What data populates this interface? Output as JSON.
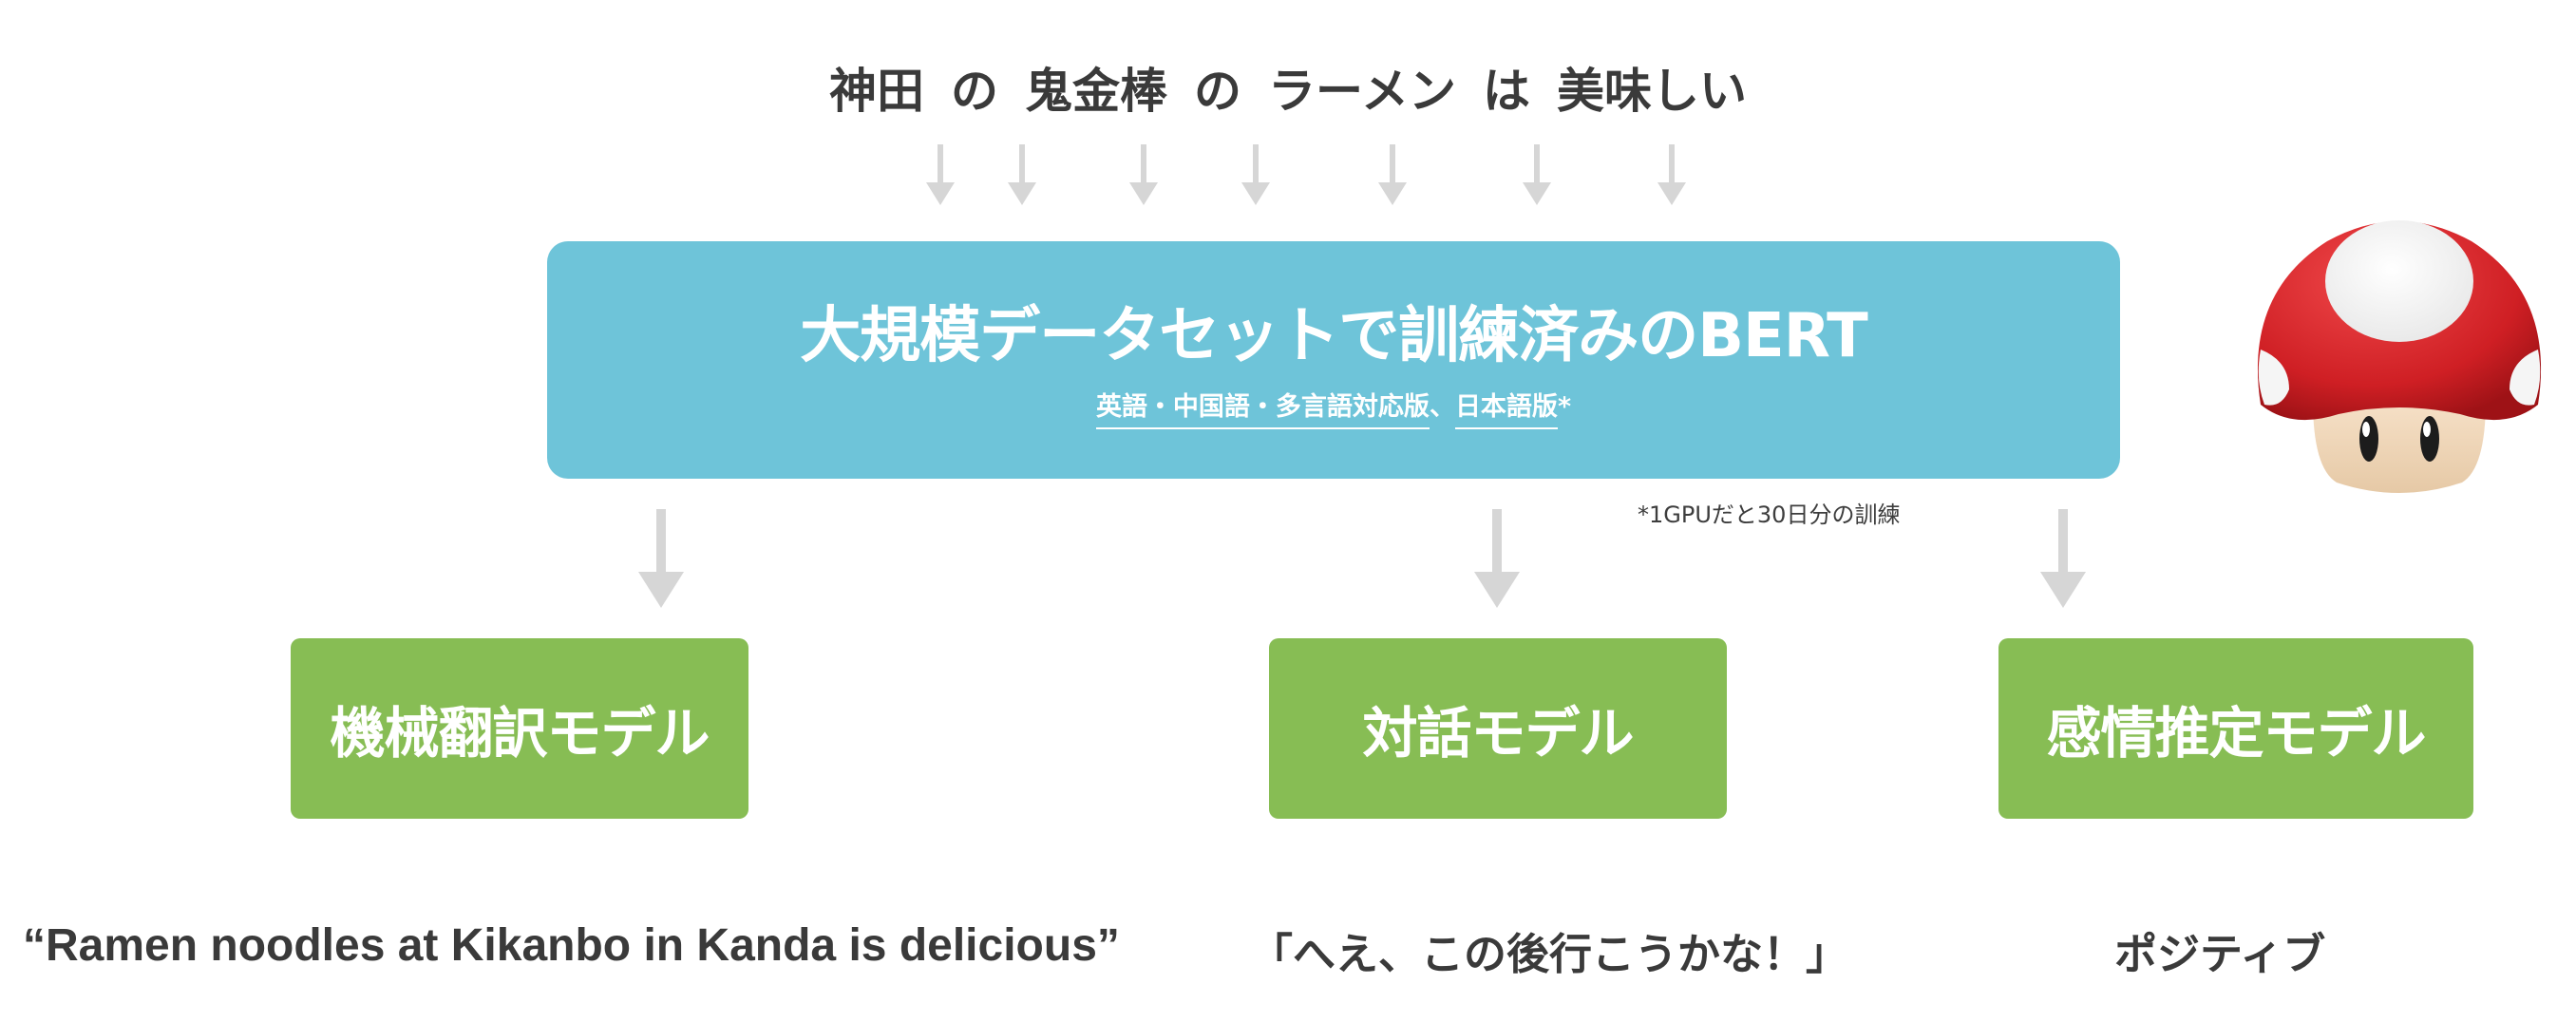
{
  "input_tokens": [
    "神田",
    "の",
    "鬼金棒",
    "の",
    "ラーメン",
    "は",
    "美味しい"
  ],
  "bert": {
    "title": "大規模データセットで訓練済みのBERT",
    "subtitle_part1": "英語・中国語・多言語対応版",
    "subtitle_sep": "、",
    "subtitle_part2": "日本語版",
    "subtitle_mark": "*"
  },
  "note": "*1GPUだと30日分の訓練",
  "models": [
    {
      "label": "機械翻訳モデル",
      "output": "“Ramen noodles at Kikanbo in Kanda is delicious”"
    },
    {
      "label": "対話モデル",
      "output": "「へえ、この後行こうかな！」"
    },
    {
      "label": "感情推定モデル",
      "output": "ポジティブ"
    }
  ],
  "colors": {
    "bert_box": "#6ec4d9",
    "model_box": "#87bd54",
    "arrow": "#d6d6d6",
    "text": "#3a3a3a"
  },
  "mascot": "mushroom-character-icon"
}
